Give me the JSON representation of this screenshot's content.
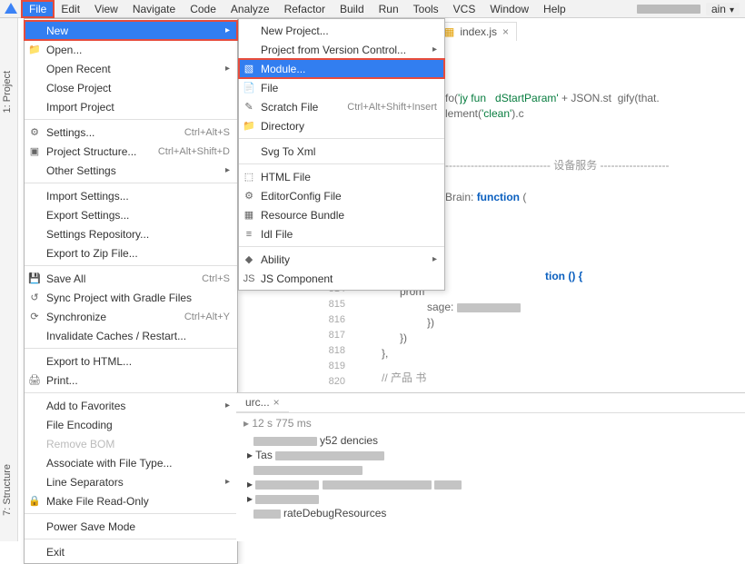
{
  "menubar": {
    "items": [
      "File",
      "Edit",
      "View",
      "Navigate",
      "Code",
      "Analyze",
      "Refactor",
      "Build",
      "Run",
      "Tools",
      "VCS",
      "Window",
      "Help"
    ],
    "right_badge": "ain"
  },
  "left_tabs": {
    "project": "1: Project",
    "structure": "7: Structure"
  },
  "editor": {
    "tab_name": "index.js",
    "frag1a": "fo(",
    "frag1b": "'jy fun",
    "frag1c": "dStartParam'",
    "frag1d": " + JSON.st",
    "frag1e": "gify(that.",
    "frag2a": "lement(",
    "frag2b": "'clean'",
    "frag2c": ").c",
    "divider": "----------------------------- 设备服务 -------------------",
    "frag3a": "Brain: ",
    "frag3b": "function",
    "frag3c": " (",
    "frag4": "tion () {",
    "frag5": "prom",
    "frag6": "sage:",
    "frag7": "})",
    "frag8": "})",
    "frag9": "},",
    "comment": "// 产品    书",
    "line_numbers": [
      "814",
      "815",
      "816",
      "817",
      "818",
      "819",
      "820"
    ]
  },
  "file_menu": [
    {
      "label": "New",
      "arrow": true,
      "selected": true,
      "box": true
    },
    {
      "label": "Open...",
      "icon": "folder"
    },
    {
      "label": "Open Recent",
      "arrow": true,
      "shortcut": ""
    },
    {
      "label": "Close Project"
    },
    {
      "label": "Import Project"
    },
    {
      "sep": true
    },
    {
      "label": "Settings...",
      "icon": "gear",
      "shortcut": "Ctrl+Alt+S"
    },
    {
      "label": "Project Structure...",
      "icon": "structure",
      "shortcut": "Ctrl+Alt+Shift+D"
    },
    {
      "label": "Other Settings",
      "arrow": true
    },
    {
      "sep": true
    },
    {
      "label": "Import Settings..."
    },
    {
      "label": "Export Settings..."
    },
    {
      "label": "Settings Repository..."
    },
    {
      "label": "Export to Zip File..."
    },
    {
      "sep": true
    },
    {
      "label": "Save All",
      "icon": "save",
      "shortcut": "Ctrl+S"
    },
    {
      "label": "Sync Project with Gradle Files",
      "icon": "sync"
    },
    {
      "label": "Synchronize",
      "icon": "refresh",
      "shortcut": "Ctrl+Alt+Y"
    },
    {
      "label": "Invalidate Caches / Restart..."
    },
    {
      "sep": true
    },
    {
      "label": "Export to HTML..."
    },
    {
      "label": "Print...",
      "icon": "print"
    },
    {
      "sep": true
    },
    {
      "label": "Add to Favorites",
      "arrow": true
    },
    {
      "label": "File Encoding"
    },
    {
      "label": "Remove BOM",
      "disabled": true
    },
    {
      "label": "Associate with File Type..."
    },
    {
      "label": "Line Separators",
      "arrow": true
    },
    {
      "label": "Make File Read-Only",
      "icon": "lock"
    },
    {
      "sep": true
    },
    {
      "label": "Power Save Mode"
    },
    {
      "sep": true
    },
    {
      "label": "Exit"
    }
  ],
  "new_menu": [
    {
      "label": "New Project..."
    },
    {
      "label": "Project from Version Control...",
      "arrow": true
    },
    {
      "label": "Module...",
      "icon": "module",
      "selected": true,
      "box": true
    },
    {
      "label": "File",
      "icon": "file"
    },
    {
      "label": "Scratch File",
      "icon": "scratch",
      "shortcut": "Ctrl+Alt+Shift+Insert"
    },
    {
      "label": "Directory",
      "icon": "folder"
    },
    {
      "sep": true
    },
    {
      "label": "Svg To Xml"
    },
    {
      "sep": true
    },
    {
      "label": "HTML File",
      "icon": "html"
    },
    {
      "label": "EditorConfig File",
      "icon": "editorconfig"
    },
    {
      "label": "Resource Bundle",
      "icon": "bundle"
    },
    {
      "label": "Idl File",
      "icon": "idl"
    },
    {
      "sep": true
    },
    {
      "label": "Ability",
      "arrow": true,
      "icon": "ability"
    },
    {
      "label": "JS Component",
      "icon": "js"
    }
  ],
  "bottom": {
    "tab": "urc...",
    "time": "12 s 775 ms",
    "lines": [
      "y52                 dencies",
      "Tas",
      "",
      "",
      "",
      "rateDebugResources"
    ]
  }
}
